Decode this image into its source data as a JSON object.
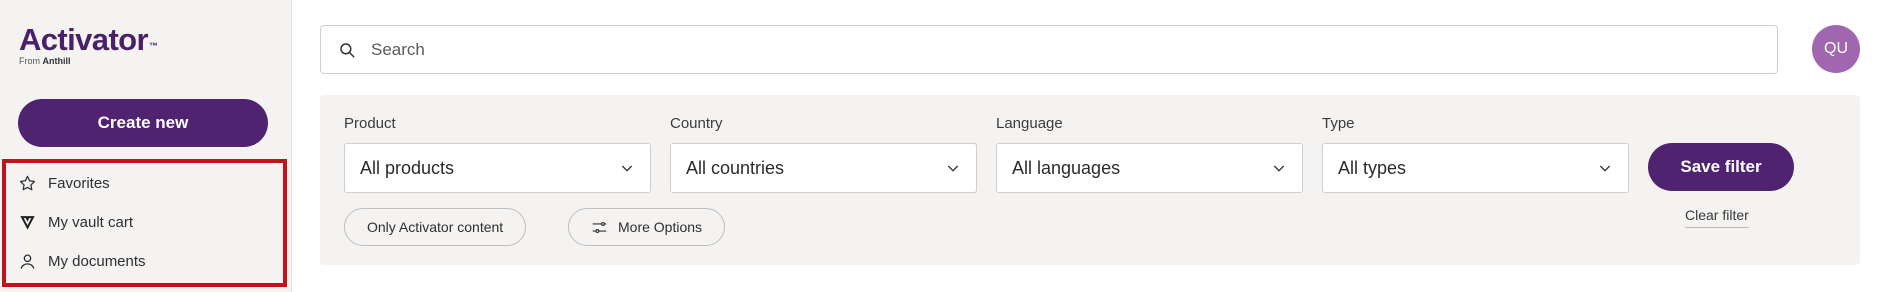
{
  "sidebar": {
    "logo": {
      "word": "Activator",
      "tm": "™",
      "from": "From",
      "brand": "Anthill"
    },
    "create_label": "Create new",
    "items": [
      {
        "label": "Favorites",
        "icon": "star-icon"
      },
      {
        "label": "My vault cart",
        "icon": "vault-v-icon"
      },
      {
        "label": "My documents",
        "icon": "user-icon"
      }
    ]
  },
  "header": {
    "search_placeholder": "Search",
    "avatar_initials": "QU"
  },
  "filters": {
    "product": {
      "label": "Product",
      "value": "All products"
    },
    "country": {
      "label": "Country",
      "value": "All countries"
    },
    "language": {
      "label": "Language",
      "value": "All languages"
    },
    "type": {
      "label": "Type",
      "value": "All types"
    },
    "save_label": "Save filter",
    "clear_label": "Clear filter",
    "only_activator_label": "Only Activator content",
    "more_options_label": "More Options"
  },
  "colors": {
    "brand_purple": "#4f2370",
    "avatar": "#a066b0",
    "highlight_border": "#c0141c"
  }
}
